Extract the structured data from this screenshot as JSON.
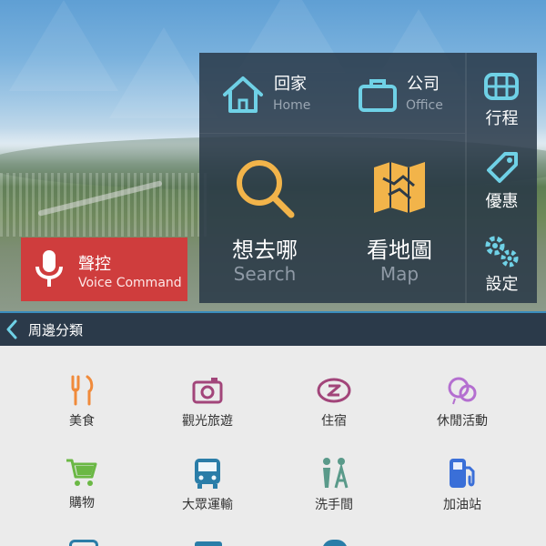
{
  "shortcuts": {
    "home": {
      "title": "回家",
      "sub": "Home"
    },
    "office": {
      "title": "公司",
      "sub": "Office"
    },
    "search": {
      "title": "想去哪",
      "sub": "Search"
    },
    "map": {
      "title": "看地圖",
      "sub": "Map"
    }
  },
  "side_menu": {
    "itinerary": "行程",
    "deals": "優惠",
    "settings": "設定"
  },
  "voice": {
    "title": "聲控",
    "sub": "Voice Command"
  },
  "category_bar": {
    "label": "周邊分類"
  },
  "categories": [
    {
      "label": "美食",
      "icon": "fork-knife-icon",
      "color": "#f08a3a"
    },
    {
      "label": "觀光旅遊",
      "icon": "camera-icon",
      "color": "#a2457a"
    },
    {
      "label": "住宿",
      "icon": "sleep-icon",
      "color": "#a2457a"
    },
    {
      "label": "休閒活動",
      "icon": "balloon-icon",
      "color": "#b46fd0"
    },
    {
      "label": "購物",
      "icon": "cart-icon",
      "color": "#6bb845"
    },
    {
      "label": "大眾運輸",
      "icon": "bus-icon",
      "color": "#2a7da8"
    },
    {
      "label": "洗手間",
      "icon": "restroom-icon",
      "color": "#5a9a8a"
    },
    {
      "label": "加油站",
      "icon": "gas-station-icon",
      "color": "#3a6fd8"
    }
  ],
  "colors": {
    "accent": "#6fd1e6",
    "panel": "#28374a",
    "voice": "#cf3d3d",
    "search_icon": "#f2b44a"
  }
}
